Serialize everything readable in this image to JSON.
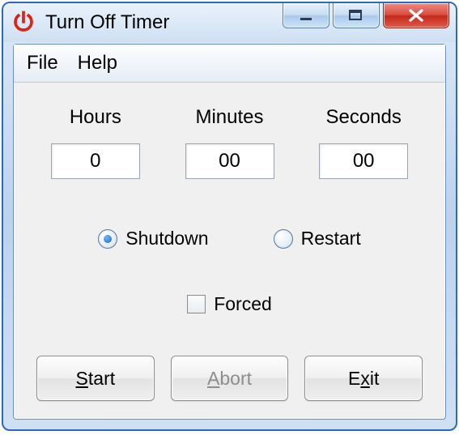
{
  "window": {
    "title": "Turn Off Timer"
  },
  "menubar": {
    "file": "File",
    "help": "Help"
  },
  "time": {
    "hours_label": "Hours",
    "minutes_label": "Minutes",
    "seconds_label": "Seconds",
    "hours_value": "0",
    "minutes_value": "00",
    "seconds_value": "00"
  },
  "options": {
    "shutdown_label": "Shutdown",
    "restart_label": "Restart",
    "shutdown_selected": true,
    "restart_selected": false,
    "forced_label": "Forced",
    "forced_checked": false
  },
  "buttons": {
    "start_mnemonic": "S",
    "start_rest": "tart",
    "abort_mnemonic": "A",
    "abort_rest": "bort",
    "exit_mnemonic": "x",
    "exit_prefix": "E",
    "exit_rest": "it",
    "abort_disabled": true
  }
}
